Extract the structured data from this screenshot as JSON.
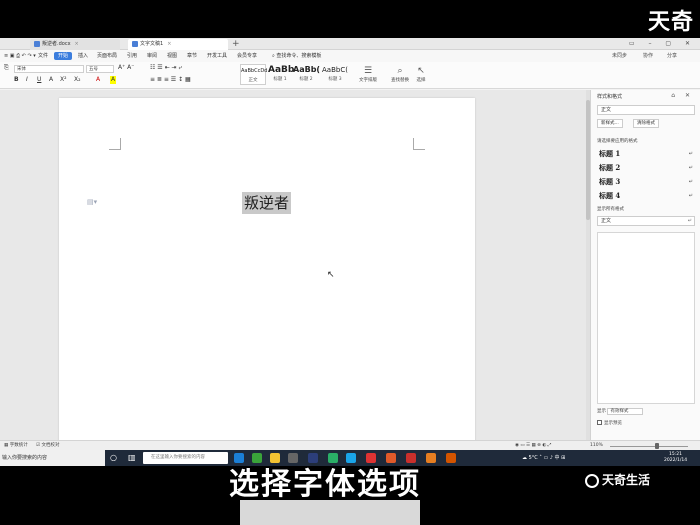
{
  "watermark": {
    "top": "天奇",
    "bottom": "天奇生活"
  },
  "caption": "选择字体选项",
  "tabs": [
    {
      "label": "叛逆者.docx",
      "active": false
    },
    {
      "label": "文字文稿1",
      "active": true
    }
  ],
  "menu": {
    "items": [
      "文件",
      "开始",
      "插入",
      "页面布局",
      "引用",
      "审阅",
      "视图",
      "章节",
      "开发工具",
      "会员专享"
    ],
    "active_index": 1,
    "search": "查找命令、搜索模板",
    "right": [
      "未同步",
      "协作",
      "分享"
    ]
  },
  "ribbon": {
    "font_name": "宋体",
    "font_size": "五号",
    "format_glyphs": [
      "B",
      "I",
      "U",
      "A",
      "X²",
      "X₂",
      "A",
      "A"
    ],
    "styles": [
      {
        "sample": "AaBbCcDd",
        "label": "正文"
      },
      {
        "sample": "AaBb",
        "label": "标题 1"
      },
      {
        "sample": "AaBb(",
        "label": "标题 2"
      },
      {
        "sample": "AaBbC(",
        "label": "标题 3"
      }
    ],
    "tools": [
      {
        "glyph": "☰",
        "label": "文字排版"
      },
      {
        "glyph": "⌕",
        "label": "查找替换"
      },
      {
        "glyph": "↖",
        "label": "选择"
      }
    ]
  },
  "document": {
    "text": "叛逆者"
  },
  "panel": {
    "title": "样式和格式",
    "current_style": "正文",
    "buttons": [
      "新样式...",
      "清除格式"
    ],
    "section_label": "请选择要应用的格式",
    "headings": [
      "标题 1",
      "标题 2",
      "标题 3",
      "标题 4"
    ],
    "source_label": "显示所有格式",
    "body_style": "正文",
    "show_label": "显示",
    "show_value": "有效样式",
    "preview_label": "显示预览"
  },
  "statusbar": {
    "left": [
      "字数统计",
      "文档校对"
    ],
    "zoom": "110%",
    "tip": "输入你要搜索的内容"
  },
  "taskbar": {
    "search_placeholder": "在这里输入你要搜索的内容",
    "weather": "5°C",
    "time": "15:21",
    "date": "2022/1/14"
  },
  "colors": {
    "accent": "#3b7ddd",
    "taskbar": "#1f2a3a"
  }
}
